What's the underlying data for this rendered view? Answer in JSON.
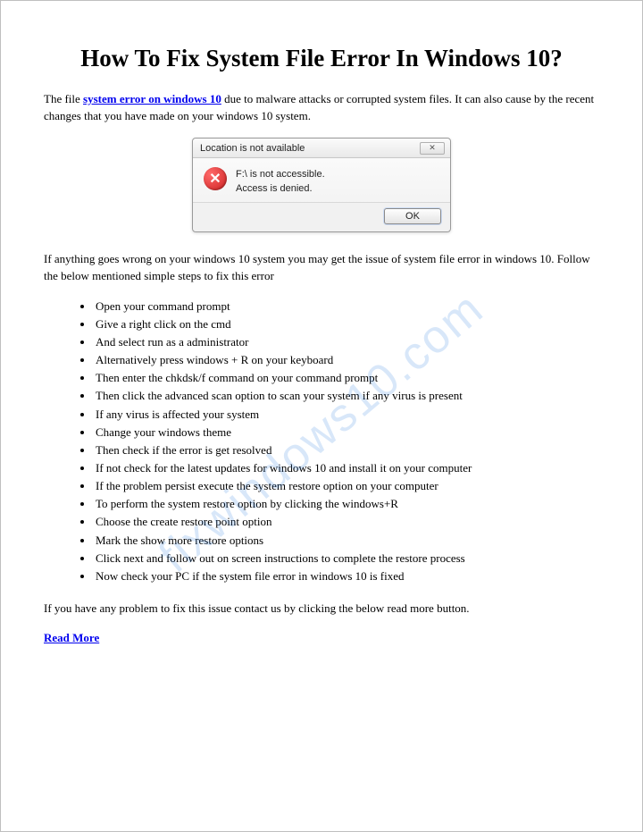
{
  "watermark": "fixwindows10.com",
  "title": "How To Fix System File Error In Windows 10?",
  "intro": {
    "pre": "The file ",
    "link": "system error on windows 10",
    "post": " due to malware attacks or corrupted system files. It can also cause by the recent changes that you have made on your windows 10 system."
  },
  "dialog": {
    "title": "Location is not available",
    "close_glyph": "✕",
    "error_glyph": "✕",
    "line1": "F:\\ is not accessible.",
    "line2": "Access is denied.",
    "ok": "OK"
  },
  "para2": "If anything goes wrong on your windows 10 system you may get the issue of system file error in windows 10. Follow the below mentioned simple steps to fix this error",
  "steps": [
    "Open your command prompt",
    "Give a right click on the cmd",
    "And select run as  a administrator",
    "Alternatively press windows + R on your keyboard",
    "Then enter the chkdsk/f command on your command prompt",
    "Then click the advanced scan option to scan your system if any virus is present",
    "If any virus is affected your system",
    "Change your windows theme",
    "Then check if the error is get resolved",
    "If not check for the latest updates for windows 10 and install it on your computer",
    "If the problem persist execute the system restore option on your computer",
    "To perform the system restore option by clicking the windows+R",
    "Choose the create restore point option",
    "Mark the show more restore options",
    "Click next and follow out on screen instructions to complete the restore process",
    "Now check your PC if the system file error in windows 10 is fixed"
  ],
  "outro": "If you have any problem to fix this issue contact us by clicking the below read more button.",
  "readmore": "Read More"
}
